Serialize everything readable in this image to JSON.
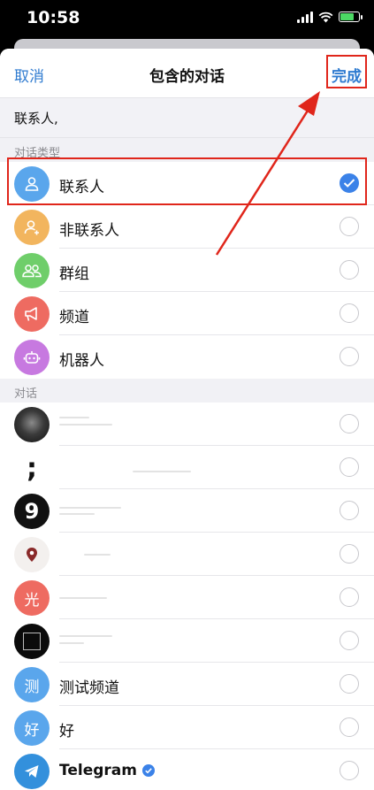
{
  "status_bar": {
    "time": "10:58"
  },
  "nav": {
    "cancel": "取消",
    "title": "包含的对话",
    "done": "完成"
  },
  "chips": {
    "text": "联系人,"
  },
  "sections": {
    "types_header": "对话类型",
    "chats_header": "对话"
  },
  "chat_types": [
    {
      "label": "联系人",
      "icon": "person-icon",
      "color": "#5aa6ec",
      "checked": true
    },
    {
      "label": "非联系人",
      "icon": "person-unknown-icon",
      "color": "#f2b55e",
      "checked": false
    },
    {
      "label": "群组",
      "icon": "group-icon",
      "color": "#6fce6a",
      "checked": false
    },
    {
      "label": "频道",
      "icon": "megaphone-icon",
      "color": "#ee6b61",
      "checked": false
    },
    {
      "label": "机器人",
      "icon": "bot-icon",
      "color": "#c779e0",
      "checked": false
    }
  ],
  "chats": [
    {
      "label": "",
      "avatar_text": "",
      "avatar_color": "#3a3a3a",
      "checked": false
    },
    {
      "label": "",
      "avatar_text": ";",
      "avatar_color": "#ffffff",
      "checked": false
    },
    {
      "label": "",
      "avatar_text": "9",
      "avatar_color": "#111111",
      "checked": false
    },
    {
      "label": "",
      "avatar_text": "",
      "avatar_color": "#f3f0ee",
      "checked": false
    },
    {
      "label": "",
      "avatar_text": "光",
      "avatar_color": "#ee6b61",
      "checked": false
    },
    {
      "label": "",
      "avatar_text": "",
      "avatar_color": "#0b0b0b",
      "checked": false
    },
    {
      "label": "测试频道",
      "avatar_text": "测",
      "avatar_color": "#5aa6ec",
      "checked": false
    },
    {
      "label": "好",
      "avatar_text": "好",
      "avatar_color": "#5aa6ec",
      "checked": false
    },
    {
      "label": "Telegram",
      "avatar_text": "",
      "avatar_color": "#3390dc",
      "checked": false
    }
  ],
  "colors": {
    "accent": "#2f7bd0",
    "annotation": "#e0261b",
    "check_on": "#3b82e8"
  }
}
